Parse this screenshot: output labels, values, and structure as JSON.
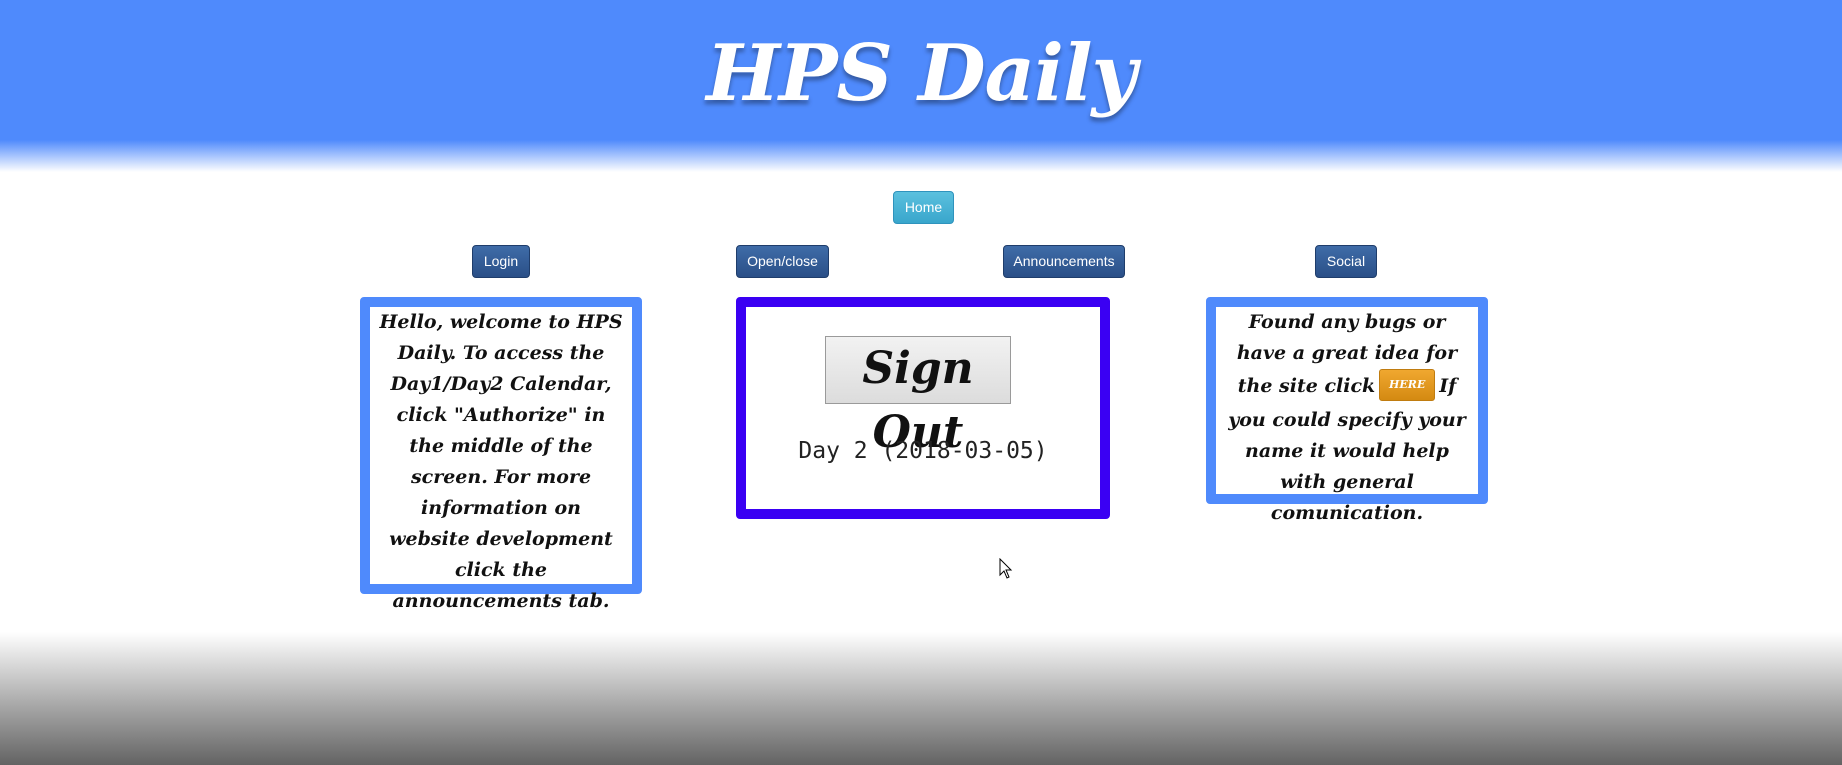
{
  "header": {
    "title": "HPS Daily",
    "color": "#4f8afc"
  },
  "nav": {
    "home": "Home",
    "login": "Login",
    "open_close": "Open/close",
    "announcements": "Announcements",
    "social": "Social"
  },
  "welcome_card": {
    "text": "Hello, welcome to HPS Daily. To access the Day1/Day2 Calendar, click \"Authorize\" in the middle of the screen. For more information on website development click the announcements tab."
  },
  "center_card": {
    "signout_label": "Sign Out",
    "day_label": "Day 2 (2018-03-05)",
    "border_color": "#3a00f3"
  },
  "feedback_card": {
    "text_before": "Found any bugs or have a great idea for the site click",
    "here_label": "HERE",
    "text_after": "If you could specify your name it would help with general comunication."
  },
  "cursor_icon": "mouse-pointer-icon"
}
